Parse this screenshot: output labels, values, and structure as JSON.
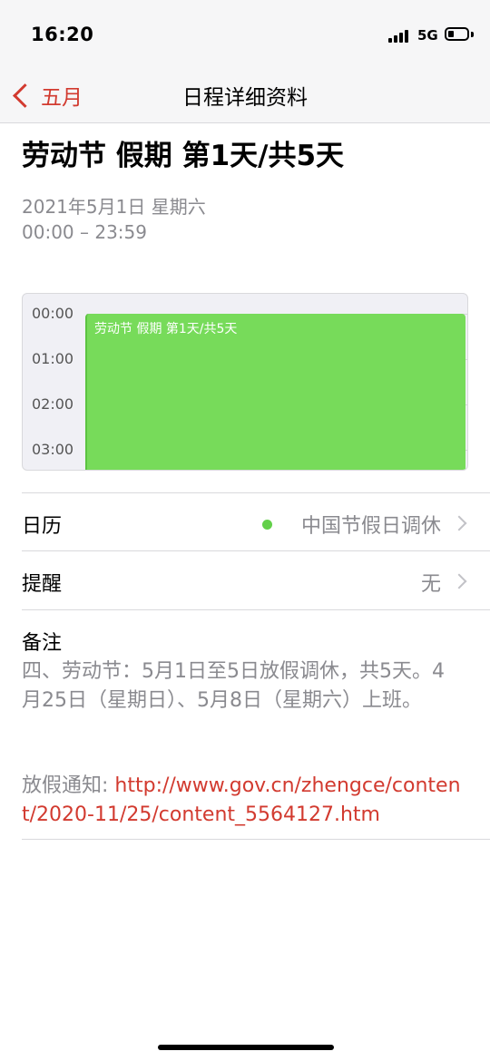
{
  "status_bar": {
    "time": "16:20",
    "network": "5G"
  },
  "nav": {
    "back_label": "五月",
    "title": "日程详细资料"
  },
  "event": {
    "title": "劳动节 假期 第1天/共5天",
    "date": "2021年5月1日 星期六",
    "time_range": "00:00 – 23:59"
  },
  "day_view": {
    "hours": [
      "00:00",
      "01:00",
      "02:00",
      "03:00"
    ],
    "event_label": "劳动节 假期 第1天/共5天",
    "event_color": "#77db5a"
  },
  "calendar_row": {
    "label": "日历",
    "value": "中国节假日调休",
    "dot_color": "#63d04a"
  },
  "alert_row": {
    "label": "提醒",
    "value": "无"
  },
  "notes": {
    "label": "备注",
    "body": "四、劳动节：5月1日至5日放假调休，共5天。4月25日（星期日）、5月8日（星期六）上班。",
    "link_prefix": "放假通知: ",
    "link_url": "http://www.gov.cn/zhengce/content/2020-11/25/content_5564127.htm"
  },
  "icons": {
    "back": "chevron-left-icon",
    "disclosure": "chevron-right-icon",
    "signal": "cellular-signal-icon",
    "battery": "battery-icon"
  },
  "colors": {
    "accent": "#d23a2f",
    "secondary_text": "#8a8a8f"
  }
}
